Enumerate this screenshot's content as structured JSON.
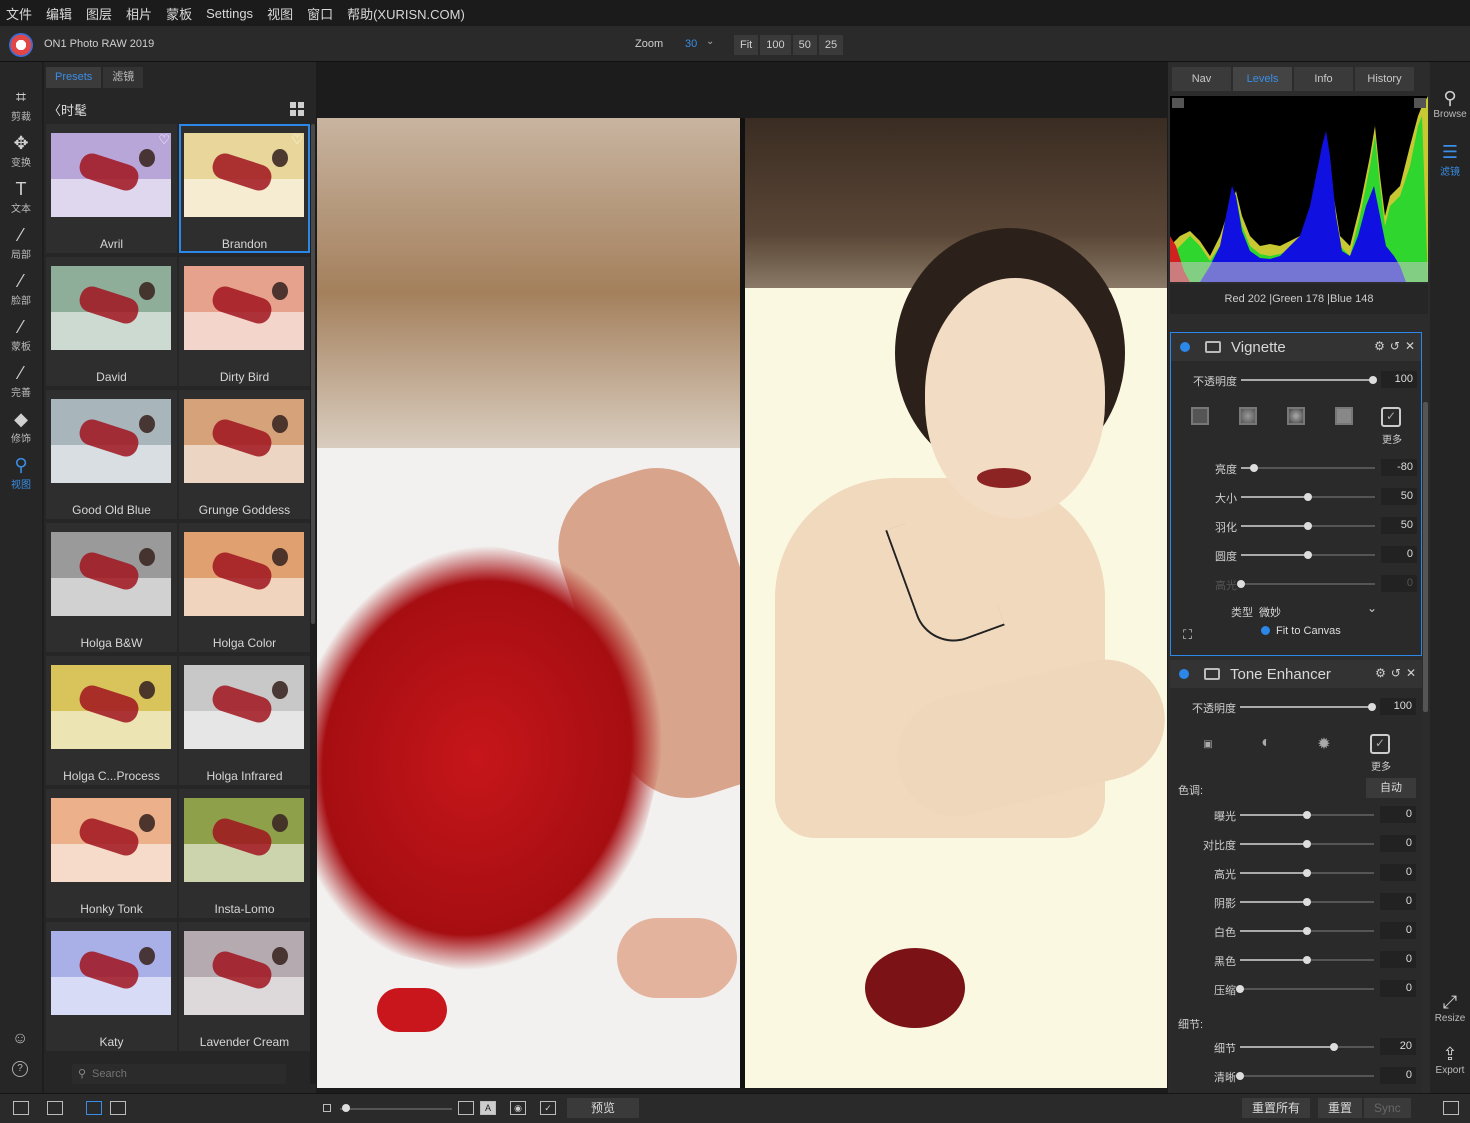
{
  "menu": [
    "文件",
    "编辑",
    "图层",
    "相片",
    "蒙板",
    "Settings",
    "视图",
    "窗口",
    "帮助(XURISN.COM)"
  ],
  "titlebar": {
    "app_title": "ON1 Photo RAW 2019",
    "zoom_label": "Zoom",
    "zoom_value": "30",
    "zoom_buttons": [
      "Fit",
      "100",
      "50",
      "25"
    ]
  },
  "tools": [
    {
      "icon": "crop-icon",
      "glyph": "⌗",
      "label": "剪裁"
    },
    {
      "icon": "move-icon",
      "glyph": "✥",
      "label": "变换"
    },
    {
      "icon": "text-icon",
      "glyph": "T",
      "label": "文本"
    },
    {
      "icon": "local-brush-icon",
      "glyph": "⁄",
      "label": "局部"
    },
    {
      "icon": "face-icon",
      "glyph": "⁄",
      "label": "脸部"
    },
    {
      "icon": "mask-brush-icon",
      "glyph": "⁄",
      "label": "蒙板"
    },
    {
      "icon": "perfect-brush-icon",
      "glyph": "⁄",
      "label": "完善"
    },
    {
      "icon": "retouch-icon",
      "glyph": "◆",
      "label": "修饰"
    },
    {
      "icon": "view-zoom-icon",
      "glyph": "⚲",
      "label": "视图"
    }
  ],
  "presets": {
    "tabs": [
      "Presets",
      "滤镜"
    ],
    "breadcrumb": "时髦",
    "search_placeholder": "Search",
    "items": [
      {
        "name": "Avril",
        "tint": "#b9a6d8"
      },
      {
        "name": "Brandon",
        "tint": "#e8d69a"
      },
      {
        "name": "David",
        "tint": "#8fae9a"
      },
      {
        "name": "Dirty Bird",
        "tint": "#e6a28c"
      },
      {
        "name": "Good Old Blue",
        "tint": "#a8b6bc"
      },
      {
        "name": "Grunge Goddess",
        "tint": "#d6a27a"
      },
      {
        "name": "Holga B&W",
        "tint": "#9a9a9a"
      },
      {
        "name": "Holga Color",
        "tint": "#e0a070"
      },
      {
        "name": "Holga C...Process",
        "tint": "#d8c45a"
      },
      {
        "name": "Holga Infrared",
        "tint": "#c8c8c8"
      },
      {
        "name": "Honky Tonk",
        "tint": "#ecb08a"
      },
      {
        "name": "Insta-Lomo",
        "tint": "#8ea04a"
      },
      {
        "name": "Katy",
        "tint": "#a9b0e8"
      },
      {
        "name": "Lavender Cream",
        "tint": "#b4aab0"
      }
    ]
  },
  "right_tabs": [
    "Nav",
    "Levels",
    "Info",
    "History"
  ],
  "histogram": {
    "red": "202",
    "green": "178",
    "blue": "148",
    "readout_labels": {
      "red": "Red",
      "green": "|Green",
      "blue": "|Blue"
    }
  },
  "vignette": {
    "title": "Vignette",
    "opacity_label": "不透明度",
    "opacity": "100",
    "more_label": "更多",
    "sliders": [
      {
        "label": "亮度",
        "value": "-80",
        "pos": 0.1
      },
      {
        "label": "大小",
        "value": "50",
        "pos": 0.5
      },
      {
        "label": "羽化",
        "value": "50",
        "pos": 0.5
      },
      {
        "label": "圆度",
        "value": "0",
        "pos": 0.5
      },
      {
        "label": "高光",
        "value": "0",
        "pos": 0.0
      }
    ],
    "type_label": "类型",
    "type_value": "微妙",
    "fit_label": "Fit to Canvas"
  },
  "tone": {
    "title": "Tone Enhancer",
    "opacity_label": "不透明度",
    "opacity": "100",
    "more_label": "更多",
    "tone_label": "色调:",
    "auto_label": "自动",
    "sliders": [
      {
        "label": "曝光",
        "value": "0",
        "pos": 0.5
      },
      {
        "label": "对比度",
        "value": "0",
        "pos": 0.5
      },
      {
        "label": "高光",
        "value": "0",
        "pos": 0.5
      },
      {
        "label": "阴影",
        "value": "0",
        "pos": 0.5
      },
      {
        "label": "白色",
        "value": "0",
        "pos": 0.5
      },
      {
        "label": "黑色",
        "value": "0",
        "pos": 0.5
      },
      {
        "label": "压缩",
        "value": "0",
        "pos": 0.0
      }
    ],
    "detail_label": "细节:",
    "detail_sliders": [
      {
        "label": "细节",
        "value": "20",
        "pos": 0.7
      },
      {
        "label": "清晰",
        "value": "0",
        "pos": 0.0
      }
    ]
  },
  "right_strip": {
    "browse": "Browse",
    "filter": "滤镜",
    "resize": "Resize",
    "export": "Export"
  },
  "bottom": {
    "preview": "预览",
    "reset_all": "重置所有",
    "reset": "重置",
    "sync": "Sync"
  },
  "colors": {
    "accent": "#2b87e8"
  }
}
